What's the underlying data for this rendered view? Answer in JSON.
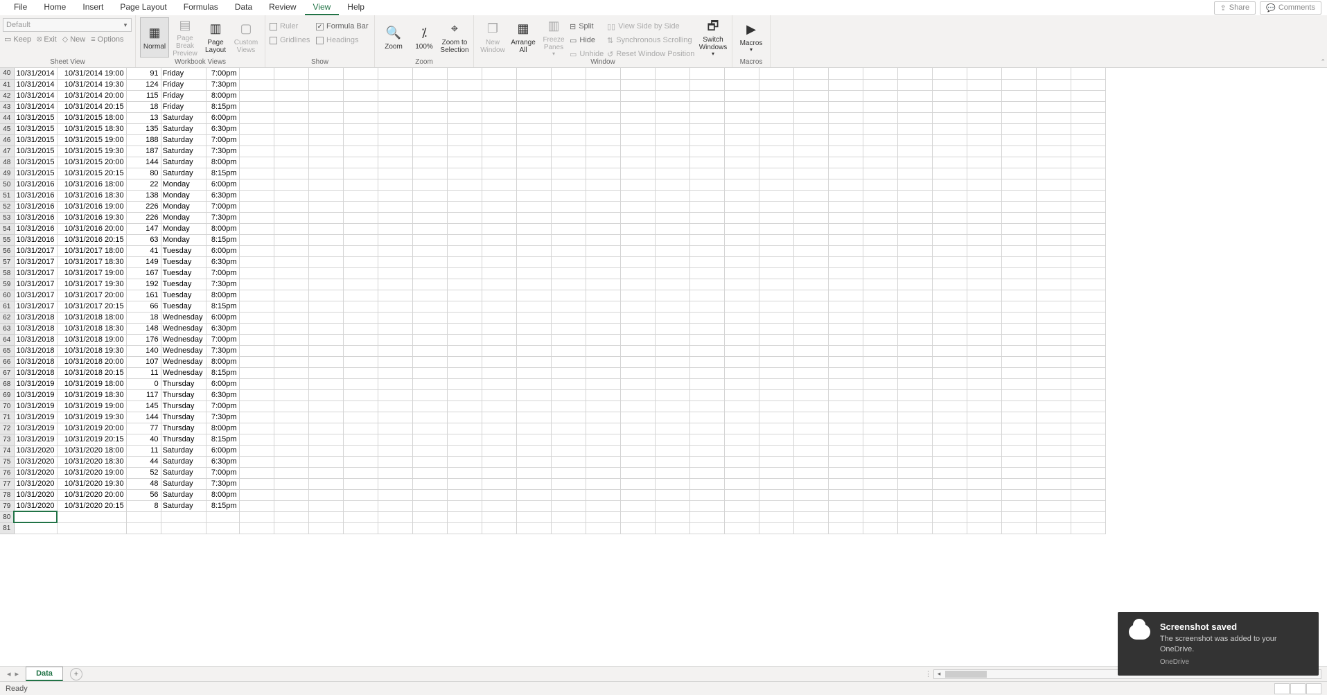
{
  "menu": {
    "items": [
      "File",
      "Home",
      "Insert",
      "Page Layout",
      "Formulas",
      "Data",
      "Review",
      "View",
      "Help"
    ],
    "active": "View",
    "share": "Share",
    "comments": "Comments"
  },
  "ribbon": {
    "sheet_view": {
      "label": "Sheet View",
      "dropdown": "Default",
      "keep": "Keep",
      "exit": "Exit",
      "new": "New",
      "options": "Options"
    },
    "workbook_views": {
      "label": "Workbook Views",
      "normal": "Normal",
      "page_break": "Page Break Preview",
      "page_layout": "Page Layout",
      "custom": "Custom Views"
    },
    "show": {
      "label": "Show",
      "ruler": "Ruler",
      "formula_bar": "Formula Bar",
      "gridlines": "Gridlines",
      "headings": "Headings"
    },
    "zoom": {
      "label": "Zoom",
      "zoom": "Zoom",
      "hundred": "100%",
      "zoom_to_selection": "Zoom to Selection"
    },
    "window": {
      "label": "Window",
      "new_window": "New Window",
      "arrange_all": "Arrange All",
      "freeze_panes": "Freeze Panes",
      "split": "Split",
      "hide": "Hide",
      "unhide": "Unhide",
      "view_side": "View Side by Side",
      "sync_scroll": "Synchronous Scrolling",
      "reset_pos": "Reset Window Position",
      "switch": "Switch Windows"
    },
    "macros": {
      "label": "Macros",
      "macros": "Macros"
    }
  },
  "grid": {
    "rows": [
      {
        "n": 40,
        "a": "10/31/2014",
        "b": "10/31/2014 19:00",
        "c": 91,
        "d": "Friday",
        "e": "7:00pm"
      },
      {
        "n": 41,
        "a": "10/31/2014",
        "b": "10/31/2014 19:30",
        "c": 124,
        "d": "Friday",
        "e": "7:30pm"
      },
      {
        "n": 42,
        "a": "10/31/2014",
        "b": "10/31/2014 20:00",
        "c": 115,
        "d": "Friday",
        "e": "8:00pm"
      },
      {
        "n": 43,
        "a": "10/31/2014",
        "b": "10/31/2014 20:15",
        "c": 18,
        "d": "Friday",
        "e": "8:15pm"
      },
      {
        "n": 44,
        "a": "10/31/2015",
        "b": "10/31/2015 18:00",
        "c": 13,
        "d": "Saturday",
        "e": "6:00pm"
      },
      {
        "n": 45,
        "a": "10/31/2015",
        "b": "10/31/2015 18:30",
        "c": 135,
        "d": "Saturday",
        "e": "6:30pm"
      },
      {
        "n": 46,
        "a": "10/31/2015",
        "b": "10/31/2015 19:00",
        "c": 188,
        "d": "Saturday",
        "e": "7:00pm"
      },
      {
        "n": 47,
        "a": "10/31/2015",
        "b": "10/31/2015 19:30",
        "c": 187,
        "d": "Saturday",
        "e": "7:30pm"
      },
      {
        "n": 48,
        "a": "10/31/2015",
        "b": "10/31/2015 20:00",
        "c": 144,
        "d": "Saturday",
        "e": "8:00pm"
      },
      {
        "n": 49,
        "a": "10/31/2015",
        "b": "10/31/2015 20:15",
        "c": 80,
        "d": "Saturday",
        "e": "8:15pm"
      },
      {
        "n": 50,
        "a": "10/31/2016",
        "b": "10/31/2016 18:00",
        "c": 22,
        "d": "Monday",
        "e": "6:00pm"
      },
      {
        "n": 51,
        "a": "10/31/2016",
        "b": "10/31/2016 18:30",
        "c": 138,
        "d": "Monday",
        "e": "6:30pm"
      },
      {
        "n": 52,
        "a": "10/31/2016",
        "b": "10/31/2016 19:00",
        "c": 226,
        "d": "Monday",
        "e": "7:00pm"
      },
      {
        "n": 53,
        "a": "10/31/2016",
        "b": "10/31/2016 19:30",
        "c": 226,
        "d": "Monday",
        "e": "7:30pm"
      },
      {
        "n": 54,
        "a": "10/31/2016",
        "b": "10/31/2016 20:00",
        "c": 147,
        "d": "Monday",
        "e": "8:00pm"
      },
      {
        "n": 55,
        "a": "10/31/2016",
        "b": "10/31/2016 20:15",
        "c": 63,
        "d": "Monday",
        "e": "8:15pm"
      },
      {
        "n": 56,
        "a": "10/31/2017",
        "b": "10/31/2017 18:00",
        "c": 41,
        "d": "Tuesday",
        "e": "6:00pm"
      },
      {
        "n": 57,
        "a": "10/31/2017",
        "b": "10/31/2017 18:30",
        "c": 149,
        "d": "Tuesday",
        "e": "6:30pm"
      },
      {
        "n": 58,
        "a": "10/31/2017",
        "b": "10/31/2017 19:00",
        "c": 167,
        "d": "Tuesday",
        "e": "7:00pm"
      },
      {
        "n": 59,
        "a": "10/31/2017",
        "b": "10/31/2017 19:30",
        "c": 192,
        "d": "Tuesday",
        "e": "7:30pm"
      },
      {
        "n": 60,
        "a": "10/31/2017",
        "b": "10/31/2017 20:00",
        "c": 161,
        "d": "Tuesday",
        "e": "8:00pm"
      },
      {
        "n": 61,
        "a": "10/31/2017",
        "b": "10/31/2017 20:15",
        "c": 66,
        "d": "Tuesday",
        "e": "8:15pm"
      },
      {
        "n": 62,
        "a": "10/31/2018",
        "b": "10/31/2018 18:00",
        "c": 18,
        "d": "Wednesday",
        "e": "6:00pm"
      },
      {
        "n": 63,
        "a": "10/31/2018",
        "b": "10/31/2018 18:30",
        "c": 148,
        "d": "Wednesday",
        "e": "6:30pm"
      },
      {
        "n": 64,
        "a": "10/31/2018",
        "b": "10/31/2018 19:00",
        "c": 176,
        "d": "Wednesday",
        "e": "7:00pm"
      },
      {
        "n": 65,
        "a": "10/31/2018",
        "b": "10/31/2018 19:30",
        "c": 140,
        "d": "Wednesday",
        "e": "7:30pm"
      },
      {
        "n": 66,
        "a": "10/31/2018",
        "b": "10/31/2018 20:00",
        "c": 107,
        "d": "Wednesday",
        "e": "8:00pm"
      },
      {
        "n": 67,
        "a": "10/31/2018",
        "b": "10/31/2018 20:15",
        "c": 11,
        "d": "Wednesday",
        "e": "8:15pm"
      },
      {
        "n": 68,
        "a": "10/31/2019",
        "b": "10/31/2019 18:00",
        "c": 0,
        "d": "Thursday",
        "e": "6:00pm"
      },
      {
        "n": 69,
        "a": "10/31/2019",
        "b": "10/31/2019 18:30",
        "c": 117,
        "d": "Thursday",
        "e": "6:30pm"
      },
      {
        "n": 70,
        "a": "10/31/2019",
        "b": "10/31/2019 19:00",
        "c": 145,
        "d": "Thursday",
        "e": "7:00pm"
      },
      {
        "n": 71,
        "a": "10/31/2019",
        "b": "10/31/2019 19:30",
        "c": 144,
        "d": "Thursday",
        "e": "7:30pm"
      },
      {
        "n": 72,
        "a": "10/31/2019",
        "b": "10/31/2019 20:00",
        "c": 77,
        "d": "Thursday",
        "e": "8:00pm"
      },
      {
        "n": 73,
        "a": "10/31/2019",
        "b": "10/31/2019 20:15",
        "c": 40,
        "d": "Thursday",
        "e": "8:15pm"
      },
      {
        "n": 74,
        "a": "10/31/2020",
        "b": "10/31/2020 18:00",
        "c": 11,
        "d": "Saturday",
        "e": "6:00pm"
      },
      {
        "n": 75,
        "a": "10/31/2020",
        "b": "10/31/2020 18:30",
        "c": 44,
        "d": "Saturday",
        "e": "6:30pm"
      },
      {
        "n": 76,
        "a": "10/31/2020",
        "b": "10/31/2020 19:00",
        "c": 52,
        "d": "Saturday",
        "e": "7:00pm"
      },
      {
        "n": 77,
        "a": "10/31/2020",
        "b": "10/31/2020 19:30",
        "c": 48,
        "d": "Saturday",
        "e": "7:30pm"
      },
      {
        "n": 78,
        "a": "10/31/2020",
        "b": "10/31/2020 20:00",
        "c": 56,
        "d": "Saturday",
        "e": "8:00pm"
      },
      {
        "n": 79,
        "a": "10/31/2020",
        "b": "10/31/2020 20:15",
        "c": 8,
        "d": "Saturday",
        "e": "8:15pm"
      }
    ],
    "empty_rows": [
      80,
      81
    ]
  },
  "sheettabs": {
    "active": "Data"
  },
  "status": {
    "ready": "Ready"
  },
  "toast": {
    "title": "Screenshot saved",
    "body": "The screenshot was added to your OneDrive.",
    "source": "OneDrive"
  }
}
